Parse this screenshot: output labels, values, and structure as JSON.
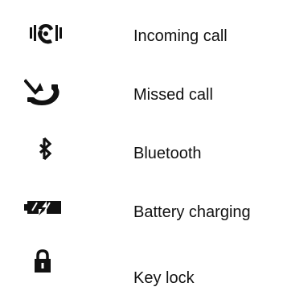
{
  "legend": {
    "items": [
      {
        "icon": "incoming-call-icon",
        "label": "Incoming call"
      },
      {
        "icon": "missed-call-icon",
        "label": "Missed call"
      },
      {
        "icon": "bluetooth-icon",
        "label": "Bluetooth"
      },
      {
        "icon": "battery-charging-icon",
        "label": "Battery charging"
      },
      {
        "icon": "key-lock-icon",
        "label": "Key lock"
      }
    ]
  },
  "colors": {
    "icon": "#111111",
    "text": "#111111",
    "background": "#ffffff"
  }
}
